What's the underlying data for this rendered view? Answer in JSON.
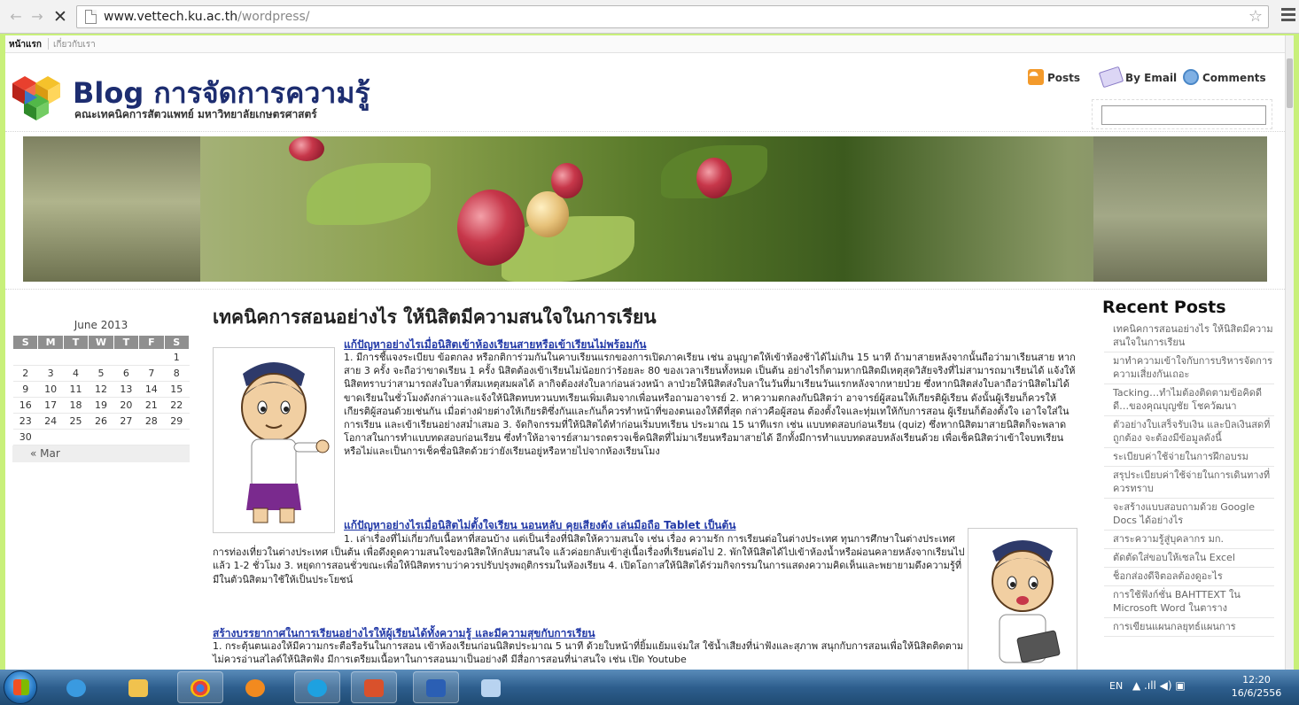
{
  "browser": {
    "url_host": "www.vettech.ku.ac.th",
    "url_path": "/wordpress/",
    "back_glyph": "←",
    "forward_glyph": "→",
    "stop_glyph": "✕",
    "star_glyph": "☆"
  },
  "nav": {
    "home": "หน้าแรก",
    "about": "เกี่ยวกับเรา"
  },
  "header": {
    "title": "Blog การจัดการความรู้",
    "subtitle": "คณะเทคนิคการสัตวแพทย์ มหาวิทยาลัยเกษตรศาสตร์",
    "feeds": {
      "posts": "Posts",
      "email": "By Email",
      "comments": "Comments"
    },
    "search_value": ""
  },
  "calendar": {
    "caption": "June 2013",
    "weekdays": [
      "S",
      "M",
      "T",
      "W",
      "T",
      "F",
      "S"
    ],
    "weeks": [
      [
        "",
        "",
        "",
        "",
        "",
        "",
        "1"
      ],
      [
        "2",
        "3",
        "4",
        "5",
        "6",
        "7",
        "8"
      ],
      [
        "9",
        "10",
        "11",
        "12",
        "13",
        "14",
        "15"
      ],
      [
        "16",
        "17",
        "18",
        "19",
        "20",
        "21",
        "22"
      ],
      [
        "23",
        "24",
        "25",
        "26",
        "27",
        "28",
        "29"
      ],
      [
        "30",
        "",
        "",
        "",
        "",
        "",
        ""
      ]
    ],
    "prev": "« Mar"
  },
  "post": {
    "title": "เทคนิคการสอนอย่างไร ให้นิสิตมีความสนใจในการเรียน",
    "sections": [
      {
        "head": "แก้ปัญหาอย่างไรเมื่อนิสิตเข้าห้องเรียนสายหรือเข้าเรียนไม่พร้อมกัน",
        "text": "1. มีการชี้แจงระเบียบ ข้อตกลง หรือกติการ่วมกันในคาบเรียนแรกของการเปิดภาคเรียน เช่น อนุญาตให้เข้าห้องช้าได้ไม่เกิน 15 นาที ถ้ามาสายหลังจากนั้นถือว่ามาเรียนสาย หากสาย 3 ครั้ง จะถือว่าขาดเรียน 1 ครั้ง นิสิตต้องเข้าเรียนไม่น้อยกว่าร้อยละ 80 ของเวลาเรียนทั้งหมด เป็นต้น อย่างไรก็ตามหากนิสิตมีเหตุสุดวิสัยจริงที่ไม่สามารถมาเรียนได้ แจ้งให้นิสิตทราบว่าสามารถส่งใบลาที่สมเหตุสมผลได้ ลากิจต้องส่งใบลาก่อนล่วงหน้า ลาป่วยให้นิสิตส่งใบลาในวันที่มาเรียนวันแรกหลังจากหายป่วย ซึ่งหากนิสิตส่งใบลาถือว่านิสิตไม่ได้ขาดเรียนในชั่วโมงดังกล่าวและแจ้งให้นิสิตทบทวนบทเรียนเพิ่มเติมจากเพื่อนหรือถามอาจารย์ 2. หาความตกลงกับนิสิตว่า อาจารย์ผู้สอนให้เกียรติผู้เรียน ดังนั้นผู้เรียนก็ควรให้เกียรติผู้สอนด้วยเช่นกัน เมื่อต่างฝ่ายต่างให้เกียรติซึ่งกันและกันก็ควรทำหน้าที่ของตนเองให้ดีที่สุด กล่าวคือผู้สอน ต้องตั้งใจและทุ่มเทให้กับการสอน ผู้เรียนก็ต้องตั้งใจ เอาใจใส่ในการเรียน และเข้าเรียนอย่างสม่ำเสมอ 3. จัดกิจกรรมที่ให้นิสิตได้ทำก่อนเริ่มบทเรียน ประมาณ 15 นาทีแรก เช่น แบบทดสอบก่อนเรียน (quiz) ซึ่งหากนิสิตมาสายนิสิตก็จะพลาดโอกาสในการทำแบบทดสอบก่อนเรียน ซึ่งทำให้อาจารย์สามารถตรวจเช็คนิสิตที่ไม่มาเรียนหรือมาสายได้ อีกทั้งมีการทำแบบทดสอบหลังเรียนด้วย เพื่อเช็คนิสิตว่าเข้าใจบทเรียนหรือไม่และเป็นการเช็คชื่อนิสิตด้วยว่ายังเรียนอยู่หรือหายไปจากห้องเรียนโมง"
      },
      {
        "head": "แก้ปัญหาอย่างไรเมื่อนิสิตไม่ตั้งใจเรียน นอนหลับ คุยเสียงดัง เล่นมือถือ Tablet เป็นต้น",
        "text": "1. เล่าเรื่องที่ไม่เกี่ยวกับเนื้อหาที่สอนบ้าง แต่เป็นเรื่องที่นิสิตให้ความสนใจ เช่น เรื่อง ความรัก การเรียนต่อในต่างประเทศ ทุนการศึกษาในต่างประเทศ การท่องเที่ยวในต่างประเทศ เป็นต้น เพื่อดึงดูดความสนใจของนิสิตให้กลับมาสนใจ แล้วค่อยกลับเข้าสู่เนื้อเรื่องที่เรียนต่อไป 2. พักให้นิสิตได้ไปเข้าห้องน้ำหรือผ่อนคลายหลังจากเรียนไปแล้ว 1-2 ชั่วโมง 3. หยุดการสอนชั่วขณะเพื่อให้นิสิตทราบว่าควรปรับปรุงพฤติกรรมในห้องเรียน 4. เปิดโอกาสให้นิสิตได้ร่วมกิจกรรมในการแสดงความคิดเห็นและพยายามดึงความรู้ที่มีในตัวนิสิตมาใช้ให้เป็นประโยชน์"
      },
      {
        "head": "สร้างบรรยากาศในการเรียนอย่างไรให้ผู้เรียนได้ทั้งความรู้ และมีความสุขกับการเรียน",
        "text": "1. กระตุ้นตนเองให้มีความกระตือรือร้นในการสอน เข้าห้องเรียนก่อนนิสิตประมาณ 5 นาที ด้วยใบหน้าที่ยิ้มแย้มแจ่มใส ใช้น้ำเสียงที่น่าฟังและสุภาพ สนุกกับการสอนเพื่อให้นิสิตติดตาม ไม่ควรอ่านสไลด์ให้นิสิตฟัง มีการเตรียมเนื้อหาในการสอนมาเป็นอย่างดี มีสื่อการสอนที่น่าสนใจ เช่น เปิด Youtube"
      }
    ]
  },
  "recent": {
    "title": "Recent Posts",
    "items": [
      "เทคนิคการสอนอย่างไร ให้นิสิตมีความสนใจในการเรียน",
      "มาทำความเข้าใจกับการบริหารจัดการความเสี่ยงกันเถอะ",
      "Tacking…ทำไมต้องติดตามข้อคิดดีดี…ของคุณบุญชัย โชควัฒนา",
      "ตัวอย่างใบเสร็จรับเงิน และบิลเงินสดที่ถูกต้อง จะต้องมีข้อมูลดังนี้",
      "ระเบียบค่าใช้จ่ายในการฝึกอบรม",
      "สรุประเบียบค่าใช้จ่ายในการเดินทางที่ควรทราบ",
      "จะสร้างแบบสอบถามด้วย Google Docs ได้อย่างไร",
      "สาระความรู้สู่บุคลากร มก.",
      "ตัดตัดใส่ขอบให้เซลใน Excel",
      "ช็อกส่องดีจิตอลต้องดูอะไร",
      "การใช้ฟังก์ชั่น BAHTTEXT ใน Microsoft Word ในตาราง",
      "การเขียนแผนกลยุทธ์แผนการ"
    ]
  },
  "taskbar": {
    "lang": "EN",
    "tray_icons": "▲  .ıll  ◀)  ▣",
    "time": "12:20",
    "date": "16/6/2556"
  }
}
